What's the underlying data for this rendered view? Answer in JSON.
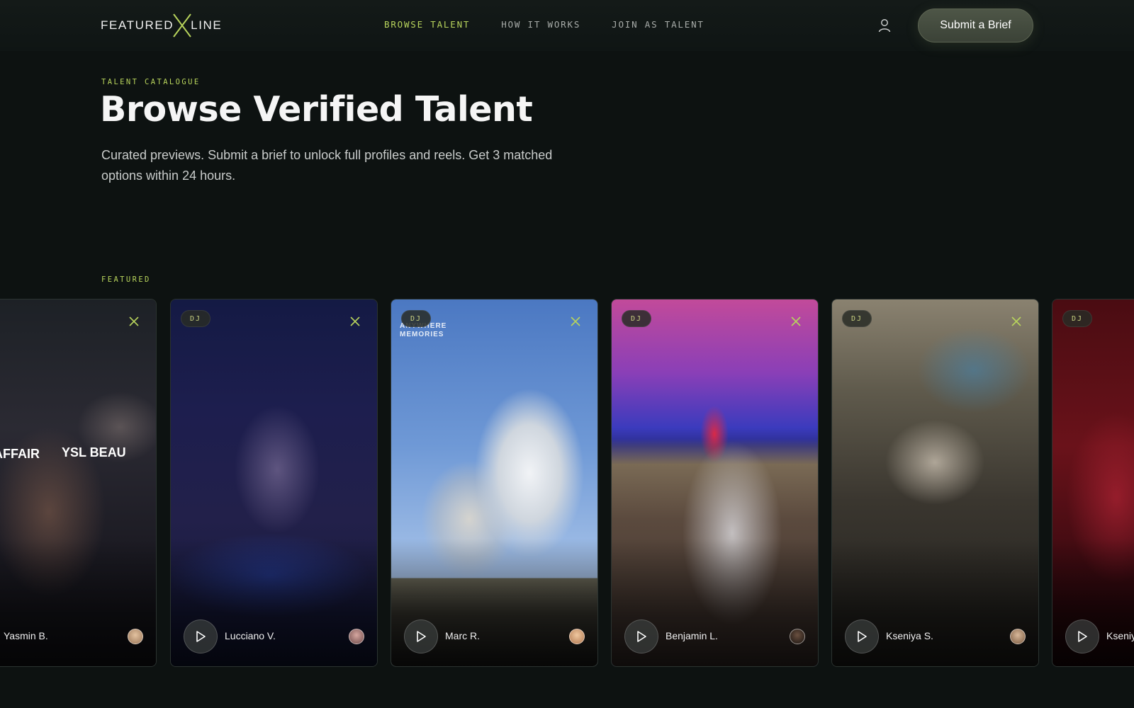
{
  "brand": {
    "left": "FEATURED",
    "right": "LINE"
  },
  "nav": {
    "items": [
      {
        "label": "BROWSE TALENT",
        "active": true
      },
      {
        "label": "HOW IT WORKS",
        "active": false
      },
      {
        "label": "JOIN AS TALENT",
        "active": false
      }
    ]
  },
  "header": {
    "cta_label": "Submit a Brief",
    "account_icon": "user-icon"
  },
  "hero": {
    "eyebrow": "TALENT CATALOGUE",
    "title": "Browse Verified Talent",
    "subtitle": "Curated previews. Submit a brief to unlock full profiles and reels. Get 3 matched options within 24 hours."
  },
  "featured": {
    "eyebrow": "FEATURED",
    "cards": [
      {
        "name": "Yasmin B.",
        "badge": "",
        "scene_text": [
          "AFFAIR",
          "YSL BEAU"
        ]
      },
      {
        "name": "Lucciano V.",
        "badge": "DJ"
      },
      {
        "name": "Marc R.",
        "badge": "DJ",
        "scene_text": [
          "ANYWHERE",
          "MEMORIES"
        ]
      },
      {
        "name": "Benjamin L.",
        "badge": "DJ"
      },
      {
        "name": "Kseniya S.",
        "badge": "DJ"
      },
      {
        "name": "Kseniya",
        "badge": "DJ"
      }
    ]
  },
  "colors": {
    "accent": "#b8d45c",
    "background": "#0d1211",
    "cta": "#4a5243"
  }
}
